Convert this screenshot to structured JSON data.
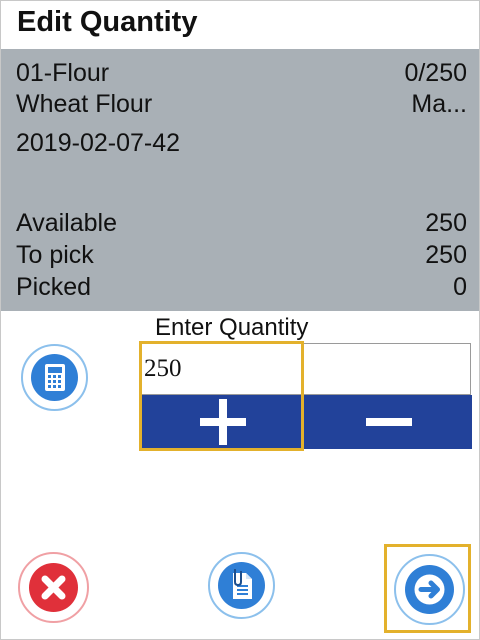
{
  "title": "Edit Quantity",
  "item": {
    "code": "01-Flour",
    "progress": "0/250",
    "name": "Wheat Flour",
    "name_right": "Ma...",
    "lot": "2019-02-07-42"
  },
  "stats": [
    {
      "label": "Available",
      "value": "250"
    },
    {
      "label": "To pick",
      "value": "250"
    },
    {
      "label": "Picked",
      "value": "0"
    }
  ],
  "entry": {
    "label": "Enter Quantity",
    "value": "250"
  },
  "icons": {
    "calculator": "calculator-icon",
    "increment": "plus-icon",
    "decrement": "minus-icon",
    "cancel": "close-icon",
    "attach": "clipboard-attachment-icon",
    "next": "arrow-right-icon"
  },
  "colors": {
    "panel": "#a9b0b6",
    "stepper": "#22429a",
    "focus": "#e3b12c",
    "cancel": "#e0303a",
    "primary": "#2f7fd6"
  }
}
